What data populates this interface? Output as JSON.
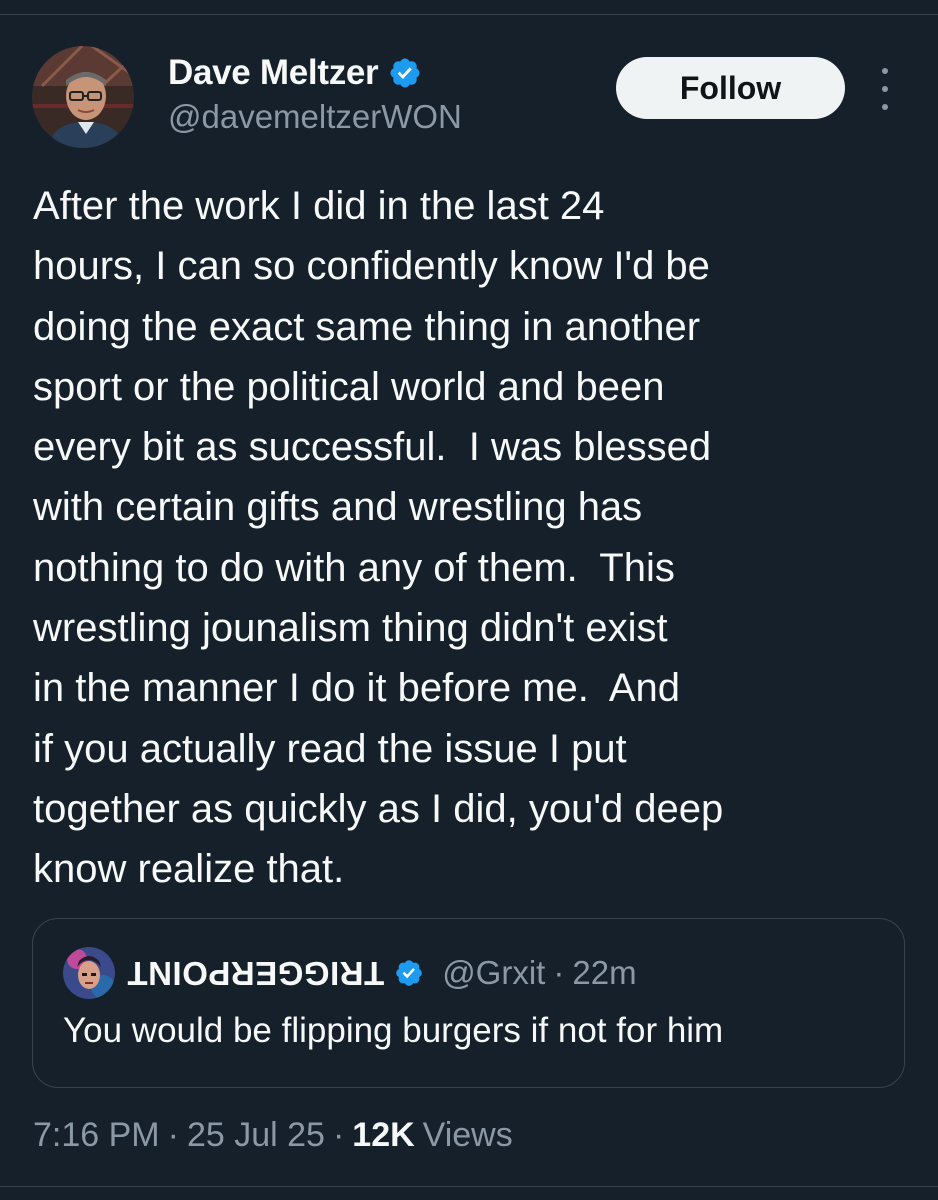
{
  "author": {
    "display_name": "Dave Meltzer",
    "handle": "@davemeltzerWON",
    "verified": true,
    "avatar_icon": "profile-photo-man-with-glasses"
  },
  "actions": {
    "follow_label": "Follow",
    "more_icon": "more-vertical-icon"
  },
  "tweet": {
    "lines": [
      "After the work I did in the last 24",
      "hours, I can so confidently know I'd be",
      "doing the exact same thing in another",
      "sport or the political world and been",
      "every bit as successful.  I was blessed",
      "with certain gifts and wrestling has",
      "nothing to do with any of them.  This",
      "wrestling jounalism thing didn't exist",
      "in the manner I do it before me.  And",
      "if you actually read the issue I put",
      "together as quickly as I did, you'd deep",
      "know realize that."
    ]
  },
  "quote": {
    "display_name": "TRIGGERPOINT",
    "display_name_note": "rendered upside-down",
    "verified": true,
    "handle": "@Grxit",
    "separator": "·",
    "time": "22m",
    "text": "You would be flipping burgers if not for him"
  },
  "meta": {
    "time": "7:16 PM",
    "separator": "·",
    "date": "25 Jul 25",
    "views_count": "12K",
    "views_label": "Views"
  },
  "colors": {
    "background": "#15202b",
    "text_primary": "#f7f9f9",
    "text_secondary": "#8b98a5",
    "border": "#38444d",
    "verified_blue": "#1d9bf0",
    "follow_bg": "#eff3f4"
  }
}
